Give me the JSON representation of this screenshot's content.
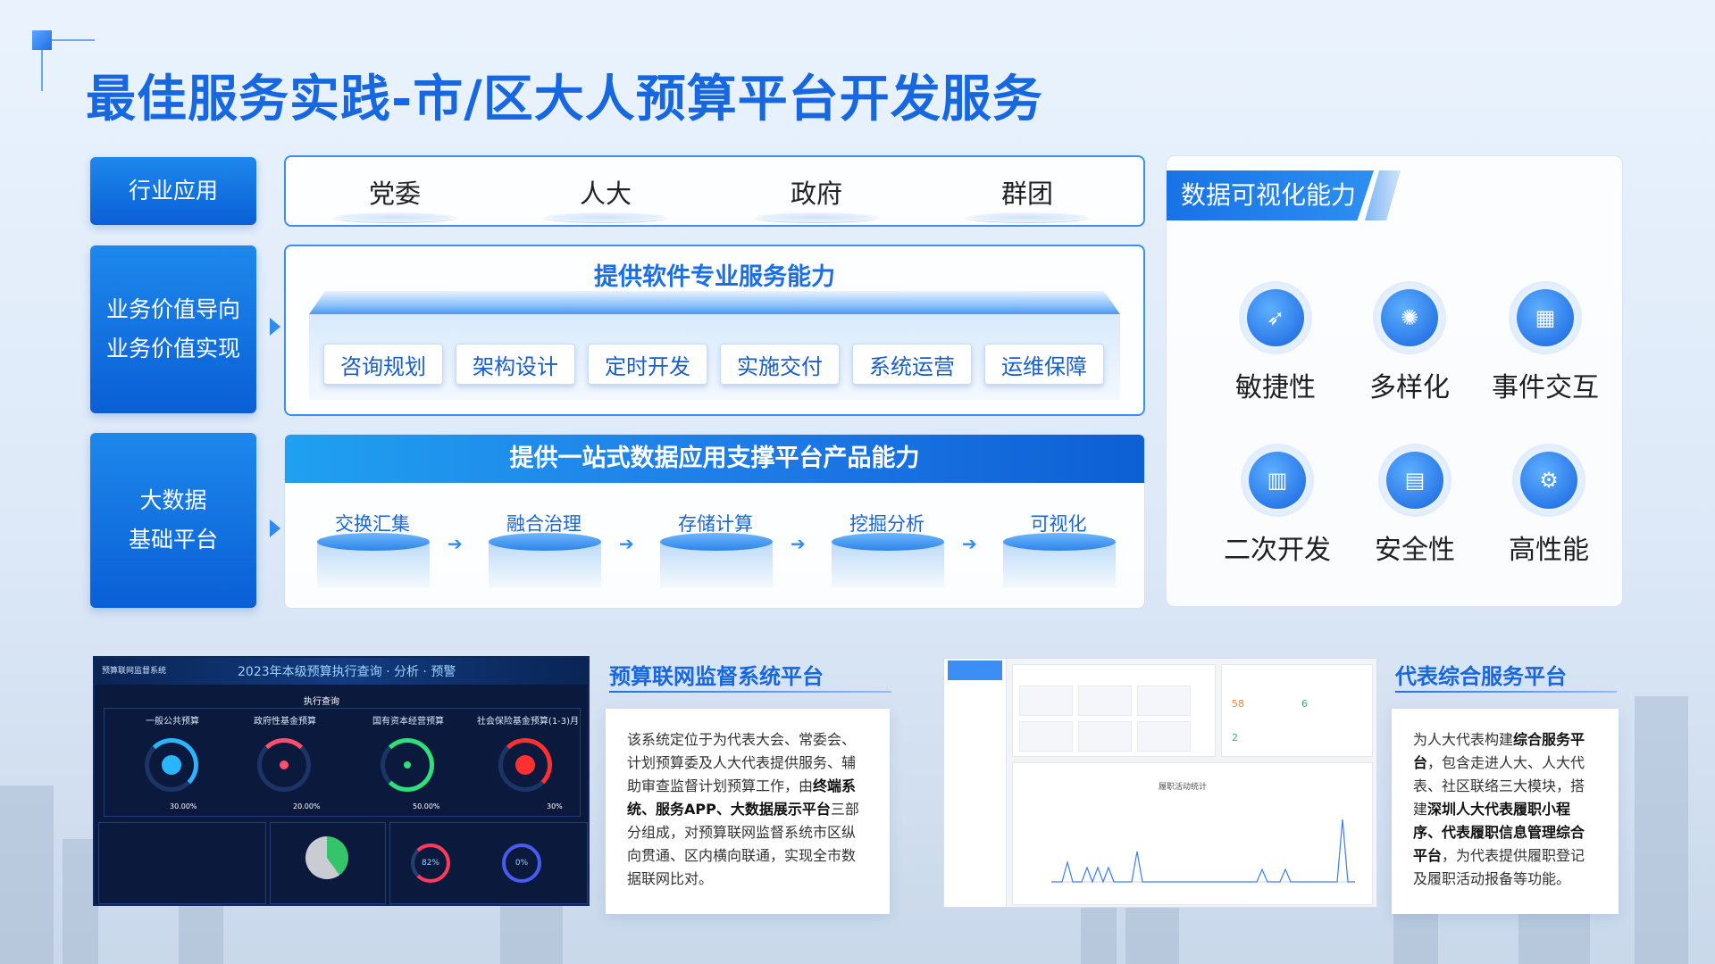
{
  "title": "最佳服务实践-市/区大人预算平台开发服务",
  "rows": {
    "industry": {
      "label_lines": [
        "行业应用"
      ],
      "sectors": [
        "党委",
        "人大",
        "政府",
        "群团"
      ]
    },
    "value": {
      "label_lines": [
        "业务价值导向",
        "业务价值实现"
      ],
      "heading": "提供软件专业服务能力",
      "services": [
        "咨询规划",
        "架构设计",
        "定时开发",
        "实施交付",
        "系统运营",
        "运维保障"
      ]
    },
    "bigdata": {
      "label_lines": [
        "大数据",
        "基础平台"
      ],
      "heading": "提供一站式数据应用支撑平台产品能力",
      "steps": [
        "交换汇集",
        "融合治理",
        "存储计算",
        "挖掘分析",
        "可视化"
      ]
    }
  },
  "visualization": {
    "title": "数据可视化能力",
    "features": [
      {
        "label": "敏捷性",
        "icon": "rocket-icon",
        "glyph": "➶"
      },
      {
        "label": "多样化",
        "icon": "network-icon",
        "glyph": "✺"
      },
      {
        "label": "事件交互",
        "icon": "dashboard-icon",
        "glyph": "▦"
      },
      {
        "label": "二次开发",
        "icon": "building-icon",
        "glyph": "▥"
      },
      {
        "label": "安全性",
        "icon": "shield-doc-icon",
        "glyph": "▤"
      },
      {
        "label": "高性能",
        "icon": "gear-icon",
        "glyph": "⚙"
      }
    ]
  },
  "cards": {
    "budget": {
      "title": "预算联网监督系统平台",
      "desc_segments": [
        {
          "t": "该系统定位于为代表大会、常委会、计划预算委及人大代表提供服务、辅助审查监督计划预算工作，由",
          "b": false
        },
        {
          "t": "终端系统、服务APP、大数据展示平台",
          "b": true
        },
        {
          "t": "三部分组成，对预算联网监督系统市区纵向贯通、区内横向联通，实现全市数据联网比对。",
          "b": false
        }
      ],
      "screenshot": {
        "org": "预算联网监督系统",
        "header": "2023年本级预算执行查询 · 分析 · 预警",
        "sub": "执行查询",
        "gauges": [
          {
            "label": "一般公共预算",
            "pct": "30.00%",
            "color": "#29b6ff"
          },
          {
            "label": "政府性基金预算",
            "pct": "20.00%",
            "color": "#ff4f6d"
          },
          {
            "label": "国有资本经营预算",
            "pct": "50.00%",
            "color": "#2ee07a"
          },
          {
            "label": "社会保险基金预算(1-3)月",
            "pct": "30%",
            "color": "#ff3030"
          }
        ],
        "pie_a": "82%",
        "pie_b": "0%"
      }
    },
    "deputy": {
      "title": "代表综合服务平台",
      "desc_segments": [
        {
          "t": "为人大代表构建",
          "b": false
        },
        {
          "t": "综合服务平台",
          "b": true
        },
        {
          "t": "，包含走进人大、人大代表、社区联络三大模块，搭建",
          "b": false
        },
        {
          "t": "深圳人大代表履职小程序、代表履职信息管理综合平台",
          "b": true
        },
        {
          "t": "，为代表提供履职登记及履职活动报备等功能。",
          "b": false
        }
      ],
      "screenshot": {
        "chart_title": "履职活动统计",
        "stats": [
          "58",
          "6",
          "2"
        ]
      }
    }
  },
  "colors": {
    "primary": "#1667e0",
    "accent": "#2f8bf2"
  }
}
